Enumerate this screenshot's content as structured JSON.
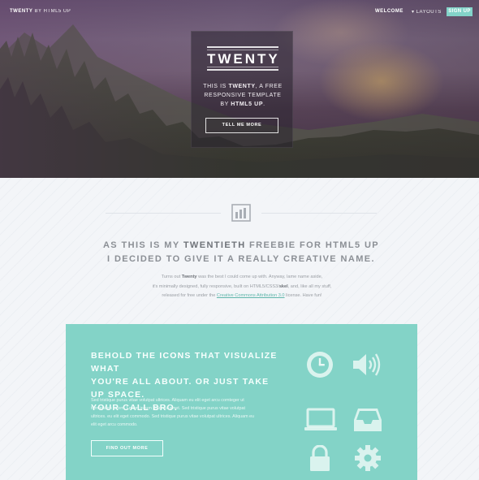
{
  "nav": {
    "brand_bold": "TWENTY",
    "brand_rest": " BY HTML5 UP",
    "welcome": "WELCOME",
    "layouts": "▾ LAYOUTS",
    "signup": "SIGN UP"
  },
  "hero": {
    "title": "TWENTY",
    "desc_line1_a": "THIS IS ",
    "desc_line1_b": "TWENTY",
    "desc_line1_c": ", A FREE",
    "desc_line2": "RESPONSIVE TEMPLATE",
    "desc_line3_a": "BY ",
    "desc_line3_b": "HTML5 UP",
    "desc_line3_c": ".",
    "button": "TELL ME MORE"
  },
  "intro": {
    "headline1_a": "AS THIS IS MY ",
    "headline1_b": "TWENTIETH",
    "headline1_c": " FREEBIE FOR HTML5 UP",
    "headline2": "I DECIDED TO GIVE IT A REALLY CREATIVE NAME.",
    "p1_a": "Turns out ",
    "p1_b": "Twenty",
    "p1_c": " was the best I could come up with. Anyway, lame name aside,",
    "p2_a": "it's minimally designed, fully responsive, built on HTML5/CSS3/",
    "p2_b": "skel",
    "p2_c": ", and, like all my stuff,",
    "p3_a": "released for free under the ",
    "p3_link": "Creative Commons Attribution 3.0",
    "p3_c": " license. Have fun!"
  },
  "feature": {
    "title1_a": "BEHOLD THE ",
    "title1_b": "ICONS",
    "title1_c": " THAT VISUALIZE WHAT",
    "title2": "YOU'RE ALL ABOUT. OR JUST TAKE UP SPACE.",
    "title3": "YOUR CALL BRO.",
    "text1": "Sed tristique purus vitae volutpat ultrices. Aliquam eu elit eget arcu comteger ut",
    "text2": "fermentum lorem. Lorem ipsum dolor sit amet. Sed tristique purus vitae volutpat",
    "text3": "ultrices. eu elit eget commodo. Sed tristique purus vitae volutpat ultrices. Aliquam eu",
    "text4": "elit eget arcu commodo.",
    "button": "FIND OUT MORE",
    "icons": [
      "clock-icon",
      "speaker-icon",
      "laptop-icon",
      "inbox-icon",
      "lock-icon",
      "gear-icon"
    ]
  },
  "colors": {
    "accent_teal": "#83d3c7",
    "page_bg": "#f3f5f8"
  }
}
